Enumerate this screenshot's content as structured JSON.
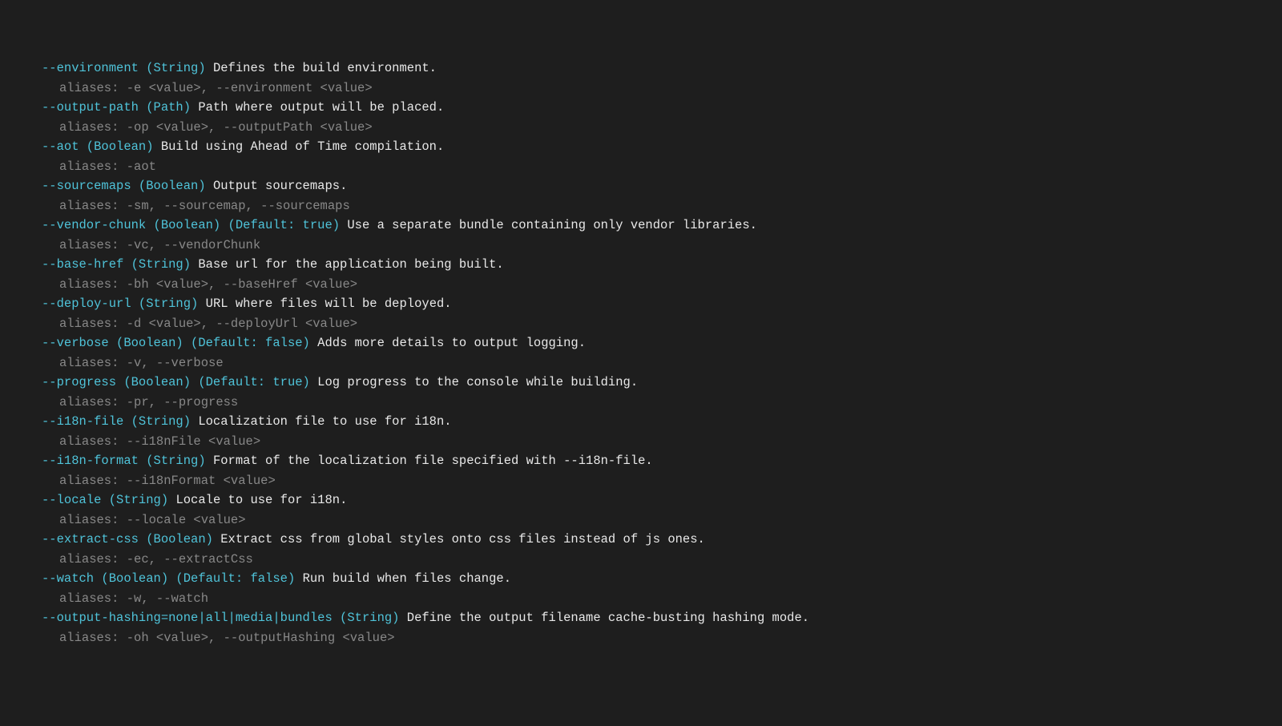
{
  "options": [
    {
      "flag": "--environment (String)",
      "desc": " Defines the build environment.",
      "aliases": "aliases: -e <value>, --environment <value>"
    },
    {
      "flag": "--output-path (Path)",
      "desc": " Path where output will be placed.",
      "aliases": "aliases: -op <value>, --outputPath <value>"
    },
    {
      "flag": "--aot (Boolean)",
      "desc": " Build using Ahead of Time compilation.",
      "aliases": "aliases: -aot"
    },
    {
      "flag": "--sourcemaps (Boolean)",
      "desc": " Output sourcemaps.",
      "aliases": "aliases: -sm, --sourcemap, --sourcemaps"
    },
    {
      "flag": "--vendor-chunk (Boolean) (Default: true)",
      "desc": " Use a separate bundle containing only vendor libraries.",
      "aliases": "aliases: -vc, --vendorChunk"
    },
    {
      "flag": "--base-href (String)",
      "desc": " Base url for the application being built.",
      "aliases": "aliases: -bh <value>, --baseHref <value>"
    },
    {
      "flag": "--deploy-url (String)",
      "desc": " URL where files will be deployed.",
      "aliases": "aliases: -d <value>, --deployUrl <value>"
    },
    {
      "flag": "--verbose (Boolean) (Default: false)",
      "desc": " Adds more details to output logging.",
      "aliases": "aliases: -v, --verbose"
    },
    {
      "flag": "--progress (Boolean) (Default: true)",
      "desc": " Log progress to the console while building.",
      "aliases": "aliases: -pr, --progress"
    },
    {
      "flag": "--i18n-file (String)",
      "desc": " Localization file to use for i18n.",
      "aliases": "aliases: --i18nFile <value>"
    },
    {
      "flag": "--i18n-format (String)",
      "desc": " Format of the localization file specified with --i18n-file.",
      "aliases": "aliases: --i18nFormat <value>"
    },
    {
      "flag": "--locale (String)",
      "desc": " Locale to use for i18n.",
      "aliases": "aliases: --locale <value>"
    },
    {
      "flag": "--extract-css (Boolean)",
      "desc": " Extract css from global styles onto css files instead of js ones.",
      "aliases": "aliases: -ec, --extractCss"
    },
    {
      "flag": "--watch (Boolean) (Default: false)",
      "desc": " Run build when files change.",
      "aliases": "aliases: -w, --watch"
    },
    {
      "flag": "--output-hashing=none|all|media|bundles (String)",
      "desc": " Define the output filename cache-busting hashing mode.",
      "aliases": "aliases: -oh <value>, --outputHashing <value>"
    }
  ]
}
